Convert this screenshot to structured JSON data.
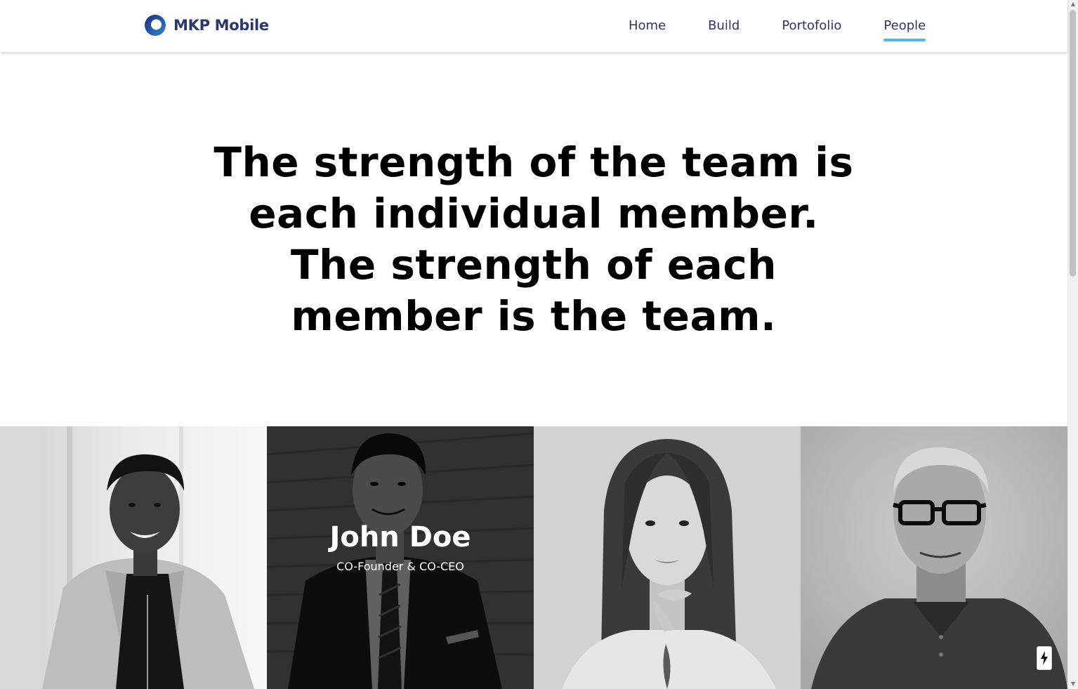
{
  "brand": {
    "name": "MKP Mobile",
    "logo_icon": "ring-logo-icon",
    "logo_color": "#2b3670",
    "ring_colors": [
      "#1a2d7a",
      "#2f86d8"
    ]
  },
  "nav": {
    "items": [
      {
        "label": "Home",
        "active": false
      },
      {
        "label": "Build",
        "active": false
      },
      {
        "label": "Portofolio",
        "active": false
      },
      {
        "label": "People",
        "active": true
      }
    ],
    "active_underline_color": "#4fb8ef"
  },
  "hero": {
    "quote": "The strength of the team is each individual member. The strength of each member is the team."
  },
  "team": {
    "members": [
      {
        "name": "",
        "role": "",
        "photo": "woman-blazer-portrait",
        "highlighted": false
      },
      {
        "name": "John Doe",
        "role": "CO-Founder & CO-CEO",
        "photo": "man-suit-portrait",
        "highlighted": true
      },
      {
        "name": "",
        "role": "",
        "photo": "woman-long-hair-portrait",
        "highlighted": false
      },
      {
        "name": "",
        "role": "",
        "photo": "man-glasses-portrait",
        "highlighted": false
      }
    ]
  },
  "floating_badge": {
    "icon": "lightning-bolt-icon"
  }
}
